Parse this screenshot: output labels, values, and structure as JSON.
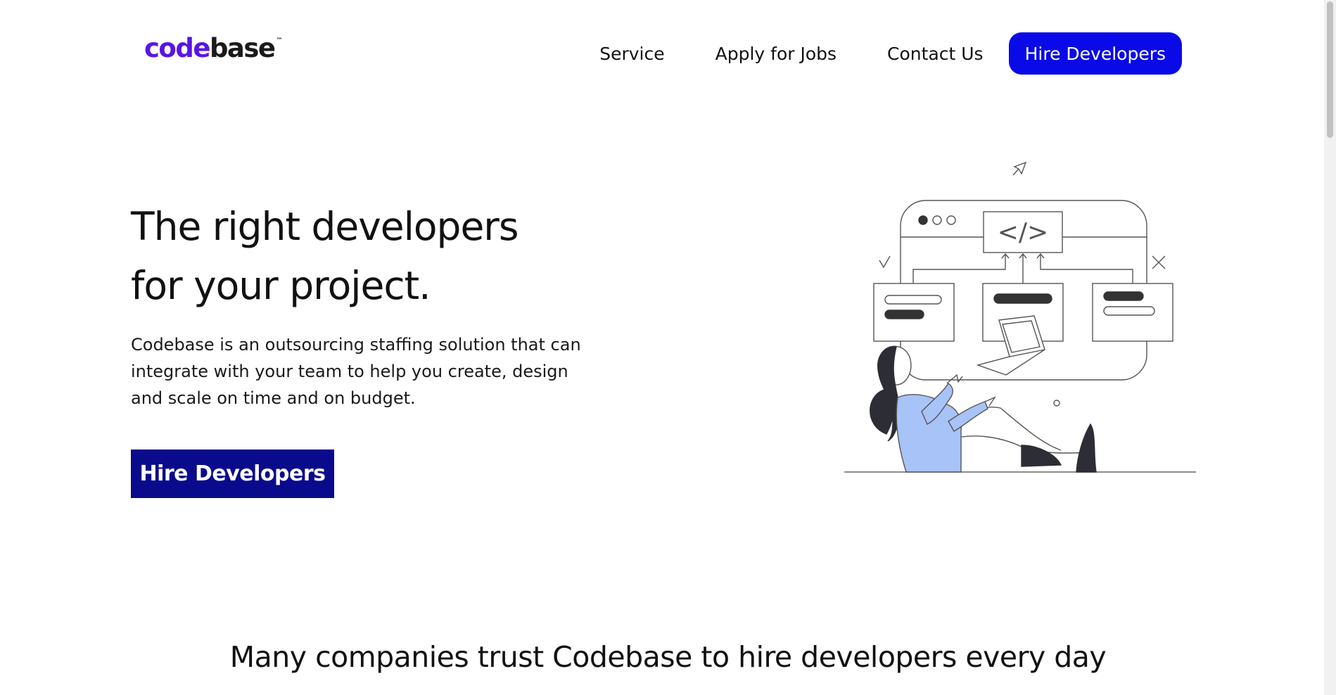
{
  "brand": {
    "logo_code": "code",
    "logo_base": "base",
    "logo_tm": "™",
    "accent_color": "#5a14e6"
  },
  "nav": {
    "items": [
      {
        "label": "Service"
      },
      {
        "label": "Apply for Jobs"
      },
      {
        "label": "Contact Us"
      }
    ],
    "cta_label": "Hire Developers",
    "cta_color": "#0a0ae8"
  },
  "hero": {
    "title_line1": "The right developers",
    "title_line2": "for your project.",
    "description": "Codebase is an outsourcing staffing solution that can integrate with your team to help you create, design and scale on time and on budget.",
    "cta_label": "Hire Developers",
    "cta_color": "#0a0a8c",
    "code_symbol": "</>"
  },
  "trust": {
    "heading": "Many companies trust Codebase to hire developers every day"
  }
}
